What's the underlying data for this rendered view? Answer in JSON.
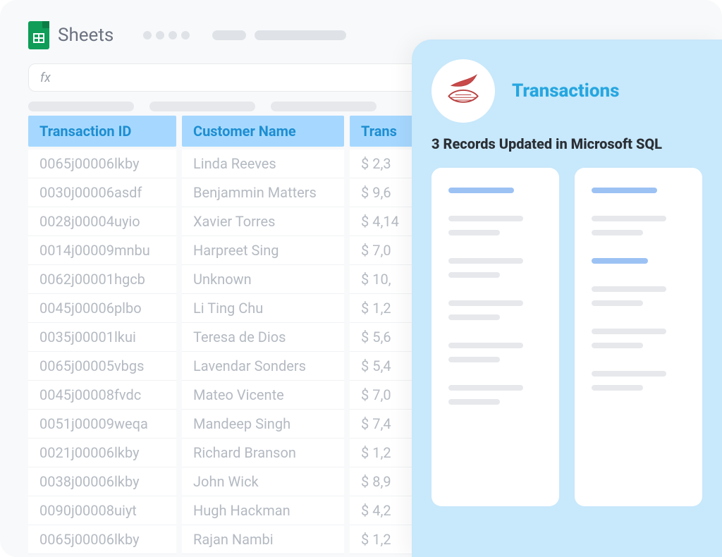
{
  "app": {
    "name": "Sheets",
    "fx_label": "fx"
  },
  "table": {
    "headers": {
      "c1": "Transaction ID",
      "c2": "Customer Name",
      "c3": "Trans"
    },
    "rows": [
      {
        "id": "0065j00006lkby",
        "name": "Linda Reeves",
        "amount": "$ 2,3"
      },
      {
        "id": "0030j00006asdf",
        "name": "Benjammin Matters",
        "amount": "$ 9,6"
      },
      {
        "id": "0028j00004uyio",
        "name": "Xavier Torres",
        "amount": "$ 4,14"
      },
      {
        "id": "0014j00009mnbu",
        "name": "Harpreet Sing",
        "amount": "$ 7,0"
      },
      {
        "id": "0062j00001hgcb",
        "name": "Unknown",
        "amount": "$ 10,"
      },
      {
        "id": "0045j00006plbo",
        "name": "Li Ting Chu",
        "amount": "$ 1,2"
      },
      {
        "id": "0035j00001lkui",
        "name": "Teresa de Dios",
        "amount": "$ 5,6"
      },
      {
        "id": "0065j00005vbgs",
        "name": "Lavendar Sonders",
        "amount": "$ 5,4"
      },
      {
        "id": "0045j00008fvdc",
        "name": "Mateo Vicente",
        "amount": "$ 7,0"
      },
      {
        "id": "0051j00009weqa",
        "name": "Mandeep Singh",
        "amount": "$ 7,4"
      },
      {
        "id": "0021j00006lkby",
        "name": "Richard Branson",
        "amount": "$ 1,2"
      },
      {
        "id": "0038j00006lkby",
        "name": "John Wick",
        "amount": "$ 8,9"
      },
      {
        "id": "0090j00008uiyt",
        "name": "Hugh Hackman",
        "amount": "$ 4,2"
      },
      {
        "id": "0065j00006lkby",
        "name": "Rajan Nambi",
        "amount": "$ 1,2"
      }
    ]
  },
  "panel": {
    "title": "Transactions",
    "status": "3 Records Updated in Microsoft SQL"
  }
}
